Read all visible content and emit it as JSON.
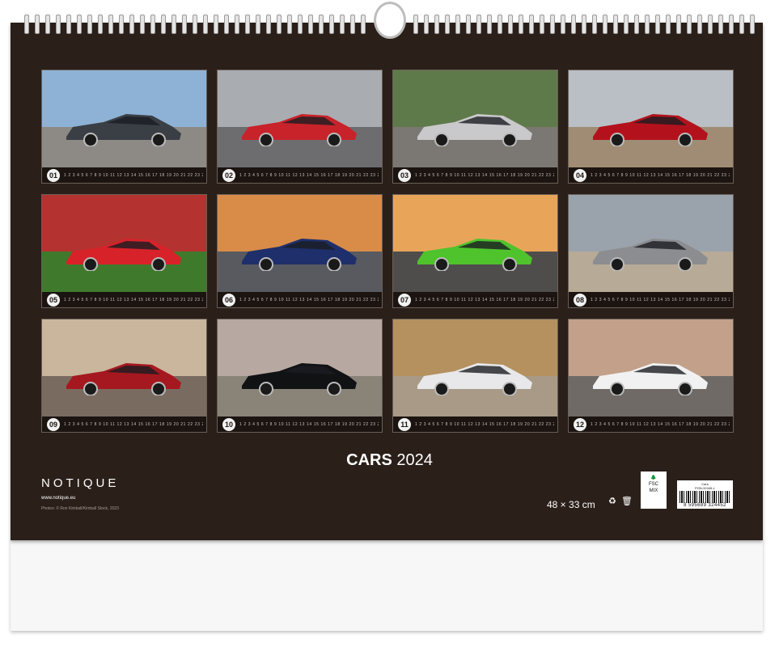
{
  "calendar": {
    "title_bold": "CARS",
    "title_year": "2024",
    "brand": "NOTIQUE",
    "url": "www.notique.eu",
    "credit": "Photos: © Ron Kimball/Kimball Stock, 2023",
    "size": "48 × 33 cm",
    "fsc_label": "FSC",
    "fsc_mix": "MIX",
    "barcode_code": "PGN-32445-L",
    "barcode_name": "Cars",
    "barcode_number": "8 595689 324452"
  },
  "months": [
    {
      "num": "01",
      "days": "1 2 3 4 5 6 7 8 9 10 11 12 13 14 15 16 17 18 19 20 21 22 23 24 25 26 27 28 29 30 31",
      "sky": "#8eb2d6",
      "ground": "#8d8a86",
      "car": "#3a3f46"
    },
    {
      "num": "02",
      "days": "1 2 3 4 5 6 7 8 9 10 11 12 13 14 15 16 17 18 19 20 21 22 23 24 25 26 27 28 29",
      "sky": "#a9acb0",
      "ground": "#6d6d6f",
      "car": "#c8232a"
    },
    {
      "num": "03",
      "days": "1 2 3 4 5 6 7 8 9 10 11 12 13 14 15 16 17 18 19 20 21 22 23 24 25 26 27 28 29 30 31",
      "sky": "#5f7a4a",
      "ground": "#7b7772",
      "car": "#c9c9cc"
    },
    {
      "num": "04",
      "days": "1 2 3 4 5 6 7 8 9 10 11 12 13 14 15 16 17 18 19 20 21 22 23 24 25 26 27 28 29 30",
      "sky": "#b9bfc5",
      "ground": "#a08c75",
      "car": "#b3121c"
    },
    {
      "num": "05",
      "days": "1 2 3 4 5 6 7 8 9 10 11 12 13 14 15 16 17 18 19 20 21 22 23 24 25 26 27 28 29 30 31",
      "sky": "#b4322f",
      "ground": "#3f7a2c",
      "car": "#d8222a"
    },
    {
      "num": "06",
      "days": "1 2 3 4 5 6 7 8 9 10 11 12 13 14 15 16 17 18 19 20 21 22 23 24 25 26 27 28 29 30",
      "sky": "#d98c48",
      "ground": "#585a60",
      "car": "#1f2f6b"
    },
    {
      "num": "07",
      "days": "1 2 3 4 5 6 7 8 9 10 11 12 13 14 15 16 17 18 19 20 21 22 23 24 25 26 27 28 29 30 31",
      "sky": "#e8a55a",
      "ground": "#4f4d4b",
      "car": "#4fc32c"
    },
    {
      "num": "08",
      "days": "1 2 3 4 5 6 7 8 9 10 11 12 13 14 15 16 17 18 19 20 21 22 23 24 25 26 27 28 29 30 31",
      "sky": "#9aa3ac",
      "ground": "#b7aa97",
      "car": "#8b8d90"
    },
    {
      "num": "09",
      "days": "1 2 3 4 5 6 7 8 9 10 11 12 13 14 15 16 17 18 19 20 21 22 23 24 25 26 27 28 29 30",
      "sky": "#c9b69c",
      "ground": "#7a6b60",
      "car": "#a5181f"
    },
    {
      "num": "10",
      "days": "1 2 3 4 5 6 7 8 9 10 11 12 13 14 15 16 17 18 19 20 21 22 23 24 25 26 27 28 29 30 31",
      "sky": "#b7a9a1",
      "ground": "#8a8378",
      "car": "#111214"
    },
    {
      "num": "11",
      "days": "1 2 3 4 5 6 7 8 9 10 11 12 13 14 15 16 17 18 19 20 21 22 23 24 25 26 27 28 29 30",
      "sky": "#b4915f",
      "ground": "#a89a86",
      "car": "#e8e8ea"
    },
    {
      "num": "12",
      "days": "1 2 3 4 5 6 7 8 9 10 11 12 13 14 15 16 17 18 19 20 21 22 23 24 25 26 27 28 29 30 31",
      "sky": "#c2a08a",
      "ground": "#6f6a66",
      "car": "#f1f1f1"
    }
  ]
}
